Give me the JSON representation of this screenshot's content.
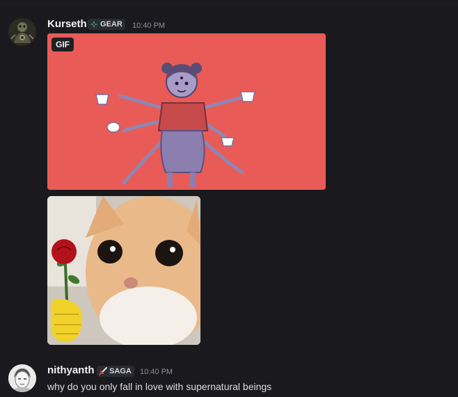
{
  "messages": [
    {
      "username": "Kurseth",
      "tag": {
        "label": "GEAR",
        "icon": "gear-cross-icon"
      },
      "timestamp": "10:40 PM",
      "gif": {
        "badge": "GIF",
        "background": "#e95b57"
      },
      "image": {
        "description_icon": "cat-with-rose-image"
      }
    },
    {
      "username": "nithyanth",
      "tag": {
        "label": "SAGA",
        "icon": "sword-icon"
      },
      "timestamp": "10:40 PM",
      "text": "why do you only fall in love with supernatural beings"
    }
  ],
  "colors": {
    "background": "#1a1a1e",
    "username": "#f2f3f5",
    "timestamp": "#8e9099",
    "tag_bg": "#2b2c31"
  }
}
